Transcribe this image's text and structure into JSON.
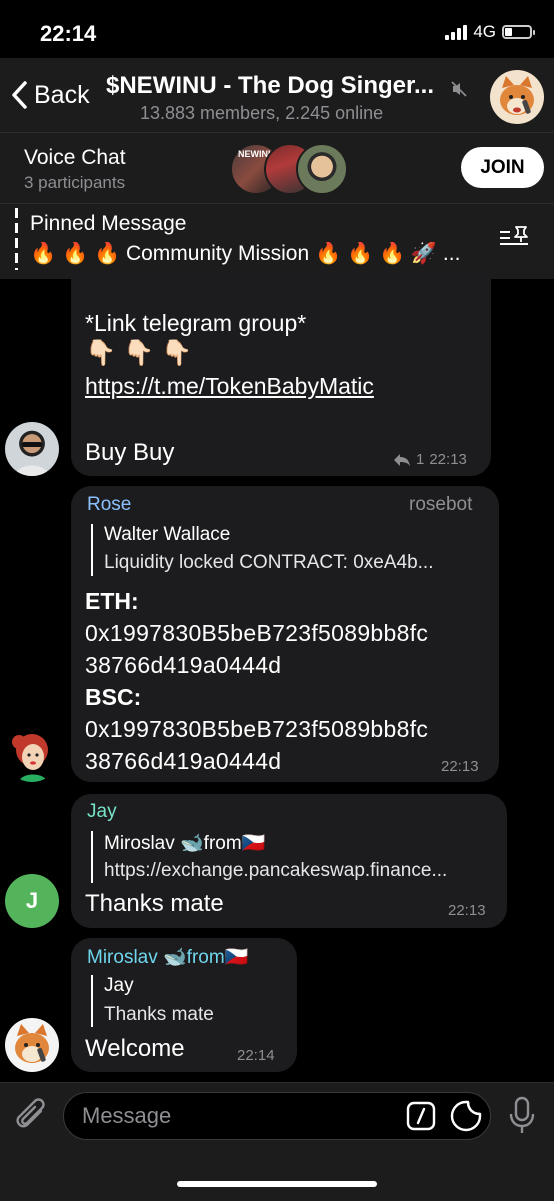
{
  "status": {
    "time": "22:14",
    "network": "4G"
  },
  "header": {
    "back_label": "Back",
    "title": "$NEWINU - The Dog Singer...",
    "subtitle": "13.883 members, 2.245 online"
  },
  "voice_chat": {
    "title": "Voice Chat",
    "participants": "3 participants",
    "join_label": "JOIN",
    "avatar_text": "NEWINU"
  },
  "pinned": {
    "title": "Pinned Message",
    "text": "🔥 🔥 🔥 Community Mission 🔥 🔥 🔥 🚀 ..."
  },
  "messages": [
    {
      "line1": "*Link telegram group*",
      "emojis": "👇🏻 👇🏻 👇🏻",
      "link": "https://t.me/TokenBabyMatic",
      "text": "Buy Buy",
      "replies": "1",
      "time": "22:13"
    },
    {
      "sender": "Rose",
      "tag": "rosebot",
      "quote_author": "Walter Wallace",
      "quote_text": "Liquidity locked   CONTRACT: 0xeA4b...",
      "eth_label": "ETH",
      "eth_addr_1": "0x1997830B5beB723f5089bb8fc",
      "eth_addr_2": "38766d419a0444d",
      "bsc_label": "BSC",
      "bsc_addr_1": "0x1997830B5beB723f5089bb8fc",
      "bsc_addr_2": "38766d419a0444d",
      "time": "22:13"
    },
    {
      "sender": "Jay",
      "avatar_letter": "J",
      "quote_author": "Miroslav 🐋from🇨🇿",
      "quote_text": "https://exchange.pancakeswap.finance...",
      "text": "Thanks mate",
      "time": "22:13"
    },
    {
      "sender": "Miroslav 🐋from🇨🇿",
      "quote_author": "Jay",
      "quote_text": "Thanks mate",
      "text": "Welcome",
      "time": "22:14"
    }
  ],
  "composer": {
    "placeholder": "Message"
  },
  "colors": {
    "rose_name": "#8cc1ff",
    "jay_name": "#76e3c8",
    "miroslav_name": "#6fd6ee",
    "jay_avatar": "#54b45c"
  }
}
